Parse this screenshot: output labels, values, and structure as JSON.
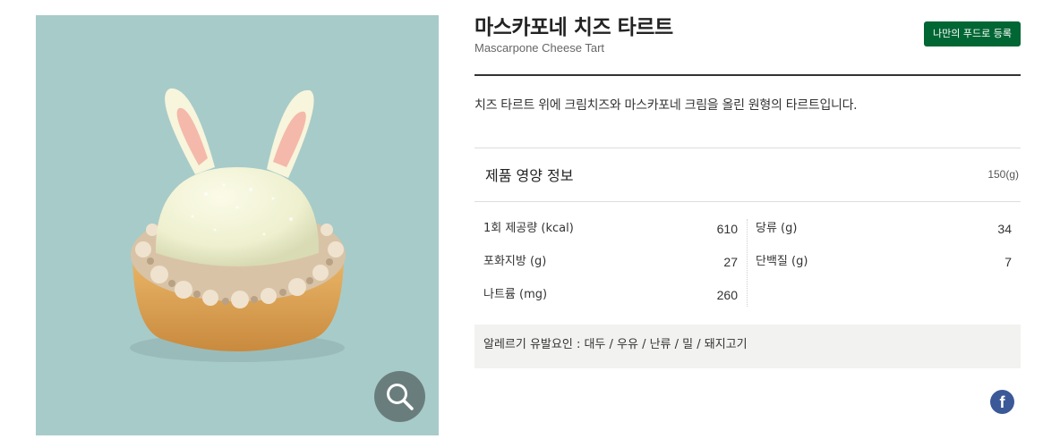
{
  "product": {
    "name_ko": "마스카포네 치즈 타르트",
    "name_en": "Mascarpone Cheese Tart",
    "register_label": "나만의 푸드로 등록",
    "description": "치즈 타르트 위에 크림치즈와 마스카포네 크림을 올린 원형의 타르트입니다.",
    "image_alt": "Mascarpone cheese tart decorated with bunny ears"
  },
  "nutrition": {
    "title": "제품 영양 정보",
    "serving_weight": "150(g)",
    "left": [
      {
        "label": "1회 제공량 (kcal)",
        "value": "610"
      },
      {
        "label": "포화지방 (g)",
        "value": "27"
      },
      {
        "label": "나트륨 (mg)",
        "value": "260"
      }
    ],
    "right": [
      {
        "label": "당류 (g)",
        "value": "34"
      },
      {
        "label": "단백질 (g)",
        "value": "7"
      }
    ]
  },
  "allergy": {
    "text": "알레르기 유발요인 : 대두 / 우유 / 난류 / 밀 / 돼지고기"
  },
  "icons": {
    "zoom": "magnifier-icon",
    "share": "facebook-icon"
  },
  "colors": {
    "image_background": "#a7cbc9",
    "register_button": "#006633",
    "facebook": "#3b5998",
    "allergy_background": "#f2f2f0"
  }
}
